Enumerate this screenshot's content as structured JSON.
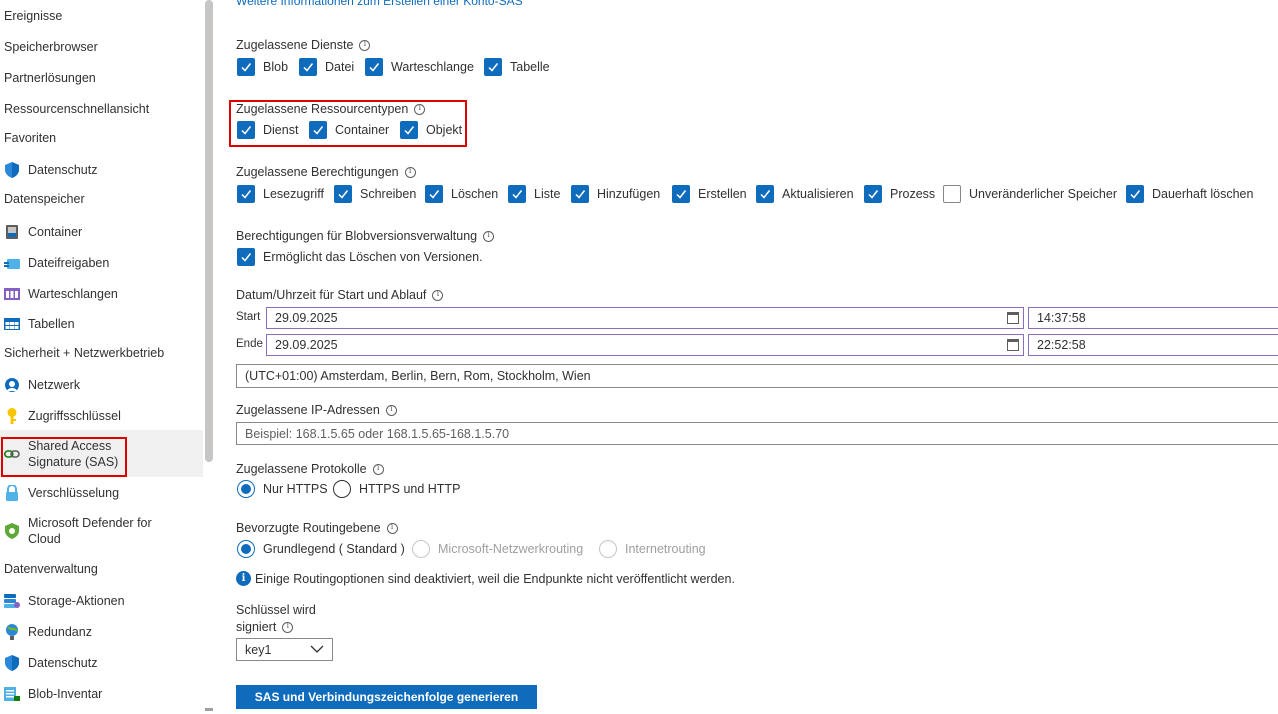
{
  "top_link": "Weitere Informationen zum Erstellen einer Konto-SAS",
  "sidebar": {
    "items": [
      {
        "label": "Ereignisse",
        "icon": null
      },
      {
        "label": "Speicherbrowser",
        "icon": null
      },
      {
        "label": "Partnerlösungen",
        "icon": null
      },
      {
        "label": "Ressourcenschnellansicht",
        "icon": null
      },
      {
        "label": "Favoriten",
        "icon": null
      },
      {
        "label": "Datenschutz",
        "icon": "shield-icon"
      },
      {
        "label": "Datenspeicher",
        "icon": null
      },
      {
        "label": "Container",
        "icon": "container-icon"
      },
      {
        "label": "Dateifreigaben",
        "icon": "file-share-icon"
      },
      {
        "label": "Warteschlangen",
        "icon": "queue-icon"
      },
      {
        "label": "Tabellen",
        "icon": "table-icon"
      },
      {
        "label": "Sicherheit + Netzwerkbetrieb",
        "icon": null
      },
      {
        "label": "Netzwerk",
        "icon": "network-icon"
      },
      {
        "label": "Zugriffsschlüssel",
        "icon": "key-icon"
      },
      {
        "label": "Shared Access Signature (SAS)",
        "icon": "link-icon"
      },
      {
        "label": "Verschlüsselung",
        "icon": "lock-icon"
      },
      {
        "label": "Microsoft Defender for Cloud",
        "icon": "defender-icon"
      },
      {
        "label": "Datenverwaltung",
        "icon": null
      },
      {
        "label": "Storage-Aktionen",
        "icon": "storage-actions-icon"
      },
      {
        "label": "Redundanz",
        "icon": "globe-icon"
      },
      {
        "label": "Datenschutz",
        "icon": "shield-icon"
      },
      {
        "label": "Blob-Inventar",
        "icon": "inventory-icon"
      }
    ],
    "sas_line1": "Shared Access",
    "sas_line2": "Signature (SAS)",
    "defender_line1": "Microsoft Defender for",
    "defender_line2": "Cloud"
  },
  "services": {
    "label": "Zugelassene Dienste",
    "options": [
      "Blob",
      "Datei",
      "Warteschlange",
      "Tabelle"
    ]
  },
  "resource_types": {
    "label": "Zugelassene Ressourcentypen",
    "options": [
      "Dienst",
      "Container",
      "Objekt"
    ]
  },
  "permissions": {
    "label": "Zugelassene Berechtigungen",
    "options": [
      "Lesezugriff",
      "Schreiben",
      "Löschen",
      "Liste",
      "Hinzufügen",
      "Erstellen",
      "Aktualisieren",
      "Prozess",
      "Unveränderlicher Speicher",
      "Dauerhaft löschen"
    ],
    "checked": [
      true,
      true,
      true,
      true,
      true,
      true,
      true,
      true,
      false,
      true
    ]
  },
  "blob_versioning": {
    "label": "Berechtigungen für Blobversionsverwaltung",
    "option": "Ermöglicht das Löschen von Versionen."
  },
  "datetime": {
    "label": "Datum/Uhrzeit für Start und Ablauf",
    "start_label": "Start",
    "start_date": "29.09.2025",
    "start_time": "14:37:58",
    "end_label": "Ende",
    "end_date": "29.09.2025",
    "end_time": "22:52:58",
    "timezone": "(UTC+01:00) Amsterdam, Berlin, Bern, Rom, Stockholm, Wien"
  },
  "ip": {
    "label": "Zugelassene IP-Adressen",
    "placeholder": "Beispiel: 168.1.5.65 oder 168.1.5.65-168.1.5.70"
  },
  "protocols": {
    "label": "Zugelassene Protokolle",
    "options": [
      "Nur HTTPS",
      "HTTPS und HTTP"
    ],
    "selected": "Nur HTTPS"
  },
  "routing": {
    "label": "Bevorzugte Routingebene",
    "options": [
      "Grundlegend ( Standard )",
      "Microsoft-Netzwerkrouting",
      "Internetrouting"
    ],
    "selected": "Grundlegend ( Standard )",
    "note": "Einige Routingoptionen sind deaktiviert, weil die Endpunkte nicht veröffentlicht werden."
  },
  "signing_key": {
    "label_line1": "Schlüssel wird",
    "label_line2": "signiert",
    "value": "key1"
  },
  "generate_button": "SAS und Verbindungszeichenfolge generieren",
  "colors": {
    "accent": "#0f6cbd",
    "highlight": "#e00000",
    "focus_border": "#8a6dbe"
  }
}
